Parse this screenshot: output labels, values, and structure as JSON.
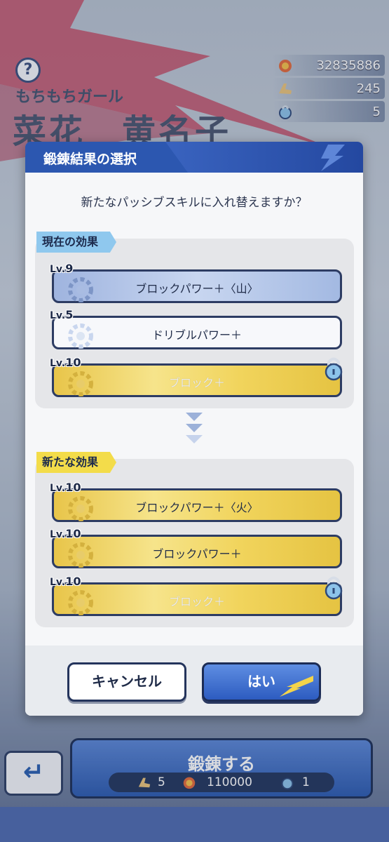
{
  "character": {
    "help": "?",
    "subtitle": "もちもちガール",
    "name": "菜花　黄名子"
  },
  "currencies": [
    {
      "icon": "fire-ball-icon",
      "value": "32835886"
    },
    {
      "icon": "wing-boots-icon",
      "value": "245"
    },
    {
      "icon": "lock-key-icon",
      "value": "5"
    }
  ],
  "modal": {
    "title": "鍛錬結果の選択",
    "question": "新たなパッシブスキルに入れ替えますか？",
    "current_label": "現在の効果",
    "new_label": "新たな効果",
    "current_skills": [
      {
        "lv_prefix": "Lv.",
        "lv": "9",
        "name": "ブロックパワー＋〈山〉",
        "style": "blue",
        "locked": false
      },
      {
        "lv_prefix": "Lv.",
        "lv": "5",
        "name": "ドリブルパワー＋",
        "style": "white",
        "locked": false
      },
      {
        "lv_prefix": "Lv.",
        "lv": "10",
        "name": "ブロック＋",
        "style": "gold",
        "locked": true
      }
    ],
    "new_skills": [
      {
        "lv_prefix": "Lv.",
        "lv": "10",
        "name": "ブロックパワー＋〈火〉",
        "style": "gold",
        "locked": false
      },
      {
        "lv_prefix": "Lv.",
        "lv": "10",
        "name": "ブロックパワー＋",
        "style": "gold",
        "locked": false
      },
      {
        "lv_prefix": "Lv.",
        "lv": "10",
        "name": "ブロック＋",
        "style": "gold",
        "locked": true
      }
    ],
    "cancel_label": "キャンセル",
    "yes_label": "はい"
  },
  "forge": {
    "label": "鍛錬する",
    "cost_boots": "5",
    "cost_fire": "110000",
    "cost_key": "1"
  },
  "back_label": "↵",
  "colors": {
    "accent_blue": "#2c57b0",
    "gold": "#f1d45c",
    "tag_current": "#8fc8ee",
    "tag_new": "#f3dc4a"
  }
}
